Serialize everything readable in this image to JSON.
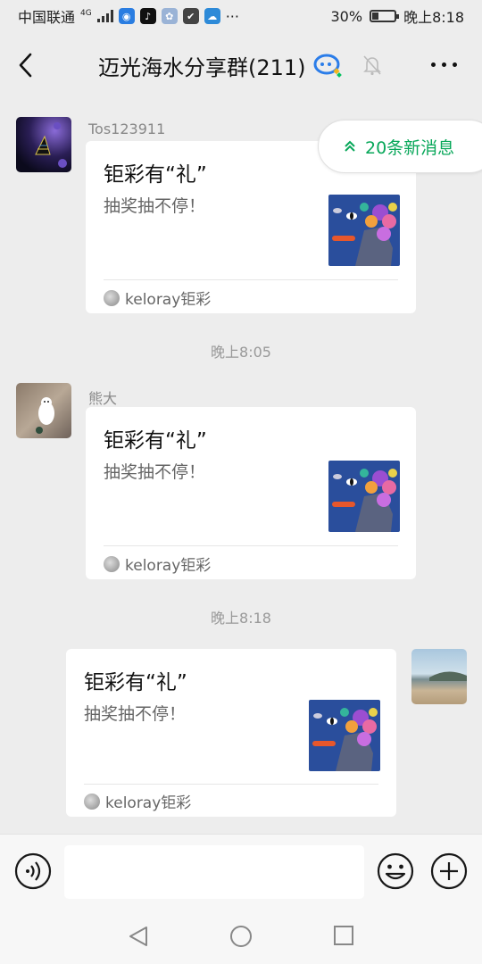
{
  "status_bar": {
    "carrier": "中国联通",
    "network": "4G",
    "battery_percent": "30%",
    "battery_level": 0.3,
    "time": "晚上8:18",
    "overflow": "···"
  },
  "header": {
    "title": "迈光海水分享群(211)",
    "icons": [
      "back-icon",
      "chatbot-icon",
      "mute-bell-icon",
      "more-icon"
    ]
  },
  "new_messages_badge": {
    "label": "20条新消息",
    "icon": "double-chevron-up-icon"
  },
  "messages": [
    {
      "sender": "Tos123911",
      "side": "left",
      "card_title": "钜彩有“礼”",
      "card_desc": "抽奖抽不停！",
      "source": "keloray钜彩"
    },
    {
      "time": "晚上8:05"
    },
    {
      "sender": "熊大",
      "side": "left",
      "card_title": "钜彩有“礼”",
      "card_desc": "抽奖抽不停！",
      "source": "keloray钜彩"
    },
    {
      "time": "晚上8:18"
    },
    {
      "side": "right",
      "card_title": "钜彩有“礼”",
      "card_desc": "抽奖抽不停！",
      "source": "keloray钜彩"
    }
  ],
  "input_bar": {
    "placeholder": "",
    "icons": [
      "voice-icon",
      "emoji-icon",
      "plus-icon"
    ]
  },
  "nav_bar": {
    "icons": [
      "nav-back-icon",
      "nav-home-icon",
      "nav-recent-icon"
    ]
  },
  "colors": {
    "accent": "#07a759",
    "background": "#ededed",
    "card": "#ffffff"
  }
}
